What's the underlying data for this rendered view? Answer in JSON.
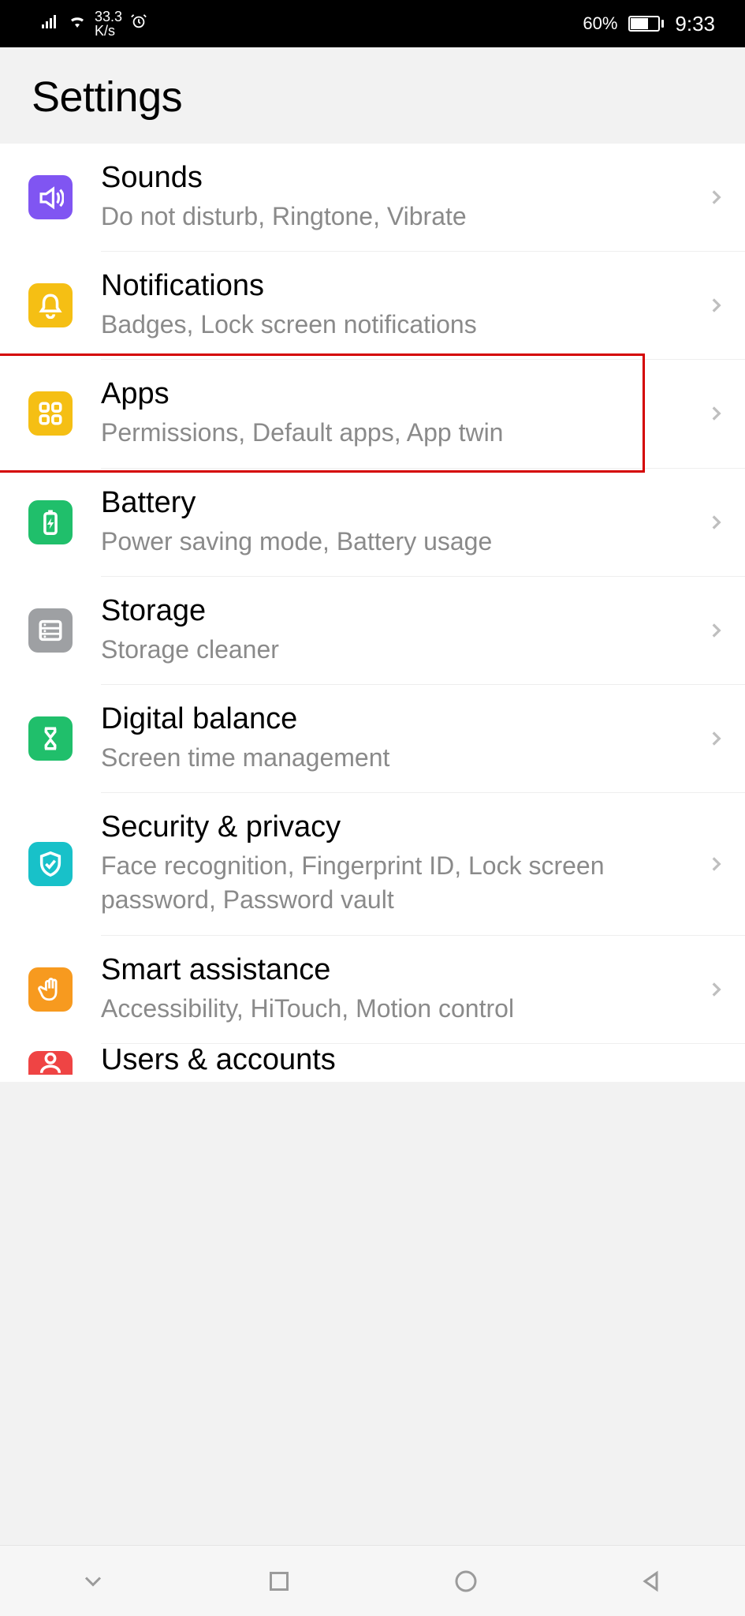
{
  "statusbar": {
    "speed_top": "33.3",
    "speed_bottom": "K/s",
    "battery_pct": "60%",
    "time": "9:33"
  },
  "header": {
    "title": "Settings"
  },
  "items": [
    {
      "icon": "volume-icon",
      "color": "bg-purple",
      "title": "Sounds",
      "subtitle": "Do not disturb, Ringtone, Vibrate"
    },
    {
      "icon": "bell-icon",
      "color": "bg-yellow",
      "title": "Notifications",
      "subtitle": "Badges, Lock screen notifications"
    },
    {
      "icon": "apps-icon",
      "color": "bg-yellow",
      "title": "Apps",
      "subtitle": "Permissions, Default apps, App twin"
    },
    {
      "icon": "battery-icon",
      "color": "bg-green",
      "title": "Battery",
      "subtitle": "Power saving mode, Battery usage"
    },
    {
      "icon": "storage-icon",
      "color": "bg-grey",
      "title": "Storage",
      "subtitle": "Storage cleaner"
    },
    {
      "icon": "hourglass-icon",
      "color": "bg-green",
      "title": "Digital balance",
      "subtitle": "Screen time management"
    },
    {
      "icon": "shield-icon",
      "color": "bg-teal",
      "title": "Security & privacy",
      "subtitle": "Face recognition, Fingerprint ID, Lock screen password, Password vault"
    },
    {
      "icon": "hand-icon",
      "color": "bg-orange",
      "title": "Smart assistance",
      "subtitle": "Accessibility, HiTouch, Motion control"
    }
  ],
  "partial": {
    "title": "Users & accounts"
  },
  "highlight_index": 2
}
